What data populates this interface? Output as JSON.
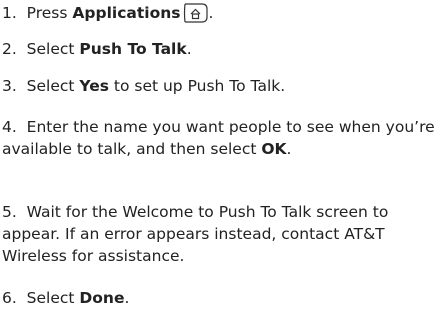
{
  "steps": [
    {
      "number": "1.",
      "before": "Press ",
      "bold": "Applications",
      "after": "",
      "icon": "applications-key-icon"
    },
    {
      "number": "2.",
      "before": "Select ",
      "bold": "Push To Talk",
      "after": "."
    },
    {
      "number": "3.",
      "before": "Select ",
      "bold": "Yes",
      "after": " to set up Push To Talk."
    },
    {
      "number": "4.",
      "before": "Enter the name you want people to see when you’re available to talk, and then select ",
      "bold": "OK",
      "after": "."
    },
    {
      "number": "5.",
      "text": "Wait for the Welcome to Push To Talk screen to appear. If an error appears instead, contact AT&T Wireless for assistance."
    },
    {
      "number": "6.",
      "before": "Select ",
      "bold": "Done",
      "after": "."
    }
  ],
  "colors": {
    "text": "#222222",
    "background": "#ffffff"
  }
}
